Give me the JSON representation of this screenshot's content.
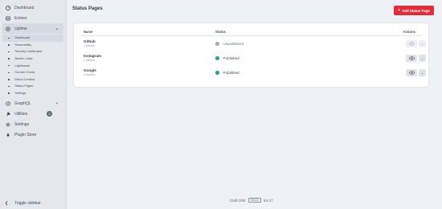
{
  "sidebar": {
    "items": [
      {
        "label": "Dashboard",
        "icon": "gauge-icon"
      },
      {
        "label": "Entries",
        "icon": "entries-icon"
      },
      {
        "label": "Uptime",
        "icon": "uptime-icon"
      }
    ],
    "uptime_subitems": [
      "Dashboard",
      "Reachability",
      "Security Certificates",
      "Broken Links",
      "Lighthouse",
      "Domain Check",
      "Mixed Content",
      "Status Pages",
      "Settings"
    ],
    "lower_items": [
      {
        "label": "GraphQL",
        "icon": "graphql-icon"
      },
      {
        "label": "Utilities",
        "icon": "wrench-icon",
        "badge": "1"
      },
      {
        "label": "Settings",
        "icon": "gear-icon"
      },
      {
        "label": "Plugin Store",
        "icon": "plug-icon"
      }
    ],
    "toggle_label": "Toggle sidebar"
  },
  "header": {
    "title": "Status Pages",
    "add_button": "Add Status Page"
  },
  "table": {
    "columns": [
      "Name",
      "Status",
      "Actions"
    ],
    "rows": [
      {
        "name": "Github",
        "sub": "1 monitor",
        "status": "Unpublished",
        "status_color": "#a3acb5"
      },
      {
        "name": "Instagram",
        "sub": "1 monitor",
        "status": "Published",
        "status_color": "#27ab83"
      },
      {
        "name": "Google",
        "sub": "1 monitor",
        "status": "Published",
        "status_color": "#27ab83"
      }
    ]
  },
  "footer": {
    "product": "Craft CMS",
    "edition": "SOLO",
    "version": "5.6.17"
  },
  "colors": {
    "accent": "#e12d39",
    "published": "#27ab83",
    "unpublished": "#a3acb5"
  }
}
